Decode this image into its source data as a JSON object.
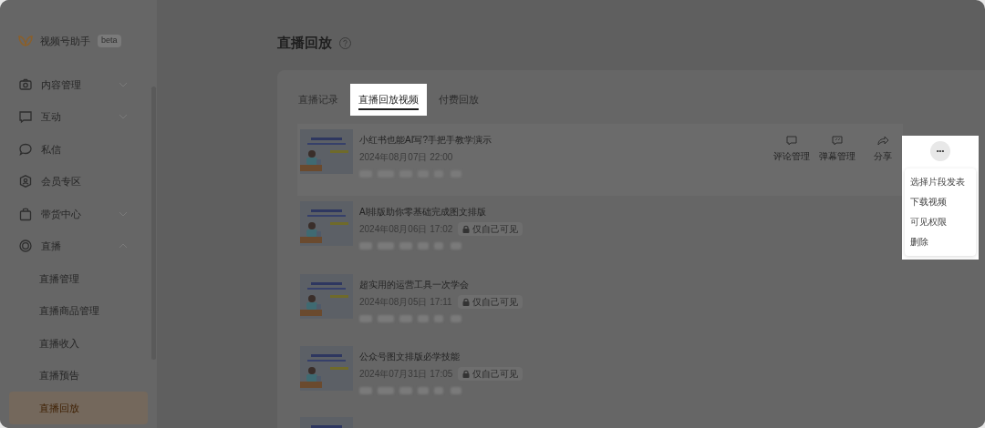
{
  "app": {
    "name": "视频号助手",
    "badge": "beta"
  },
  "sidebar": {
    "items": [
      {
        "kind": "group",
        "label": "内容管理",
        "expanded": false
      },
      {
        "kind": "group",
        "label": "互动",
        "expanded": false
      },
      {
        "kind": "link",
        "label": "私信"
      },
      {
        "kind": "link",
        "label": "会员专区"
      },
      {
        "kind": "group",
        "label": "带货中心",
        "expanded": false
      },
      {
        "kind": "group",
        "label": "直播",
        "expanded": true,
        "children": [
          {
            "label": "直播管理",
            "selected": false
          },
          {
            "label": "直播商品管理",
            "selected": false
          },
          {
            "label": "直播收入",
            "selected": false
          },
          {
            "label": "直播预告",
            "selected": false
          },
          {
            "label": "直播回放",
            "selected": true
          }
        ]
      }
    ]
  },
  "page": {
    "title": "直播回放"
  },
  "tabs": [
    {
      "label": "直播记录",
      "selected": false
    },
    {
      "label": "直播回放视频",
      "selected": true
    },
    {
      "label": "付费回放",
      "selected": false
    }
  ],
  "videos": [
    {
      "kind": "video",
      "title": "小红书也能AI写?手把手教学演示",
      "date": "2024年08月07日 22:00",
      "private": false,
      "hovered": true
    },
    {
      "kind": "video",
      "title": "AI排版助你零基础完成图文排版",
      "date": "2024年08月06日 17:02",
      "private": true,
      "private_label": "仅自己可见",
      "hovered": false
    },
    {
      "kind": "video",
      "title": "超实用的运营工具一次学会",
      "date": "2024年08月05日 17:11",
      "private": true,
      "private_label": "仅自己可见",
      "hovered": false
    },
    {
      "kind": "video",
      "title": "公众号图文排版必学技能",
      "date": "2024年07月31日 17:05",
      "private": true,
      "private_label": "仅自己可见",
      "hovered": false
    },
    {
      "kind": "cut"
    }
  ],
  "row_actions": [
    {
      "label": "评论管理"
    },
    {
      "label": "弹幕管理"
    },
    {
      "label": "分享"
    }
  ],
  "more_menu": {
    "button": "•••",
    "items": [
      "选择片段发表",
      "下载视频",
      "可见权限",
      "删除"
    ]
  }
}
